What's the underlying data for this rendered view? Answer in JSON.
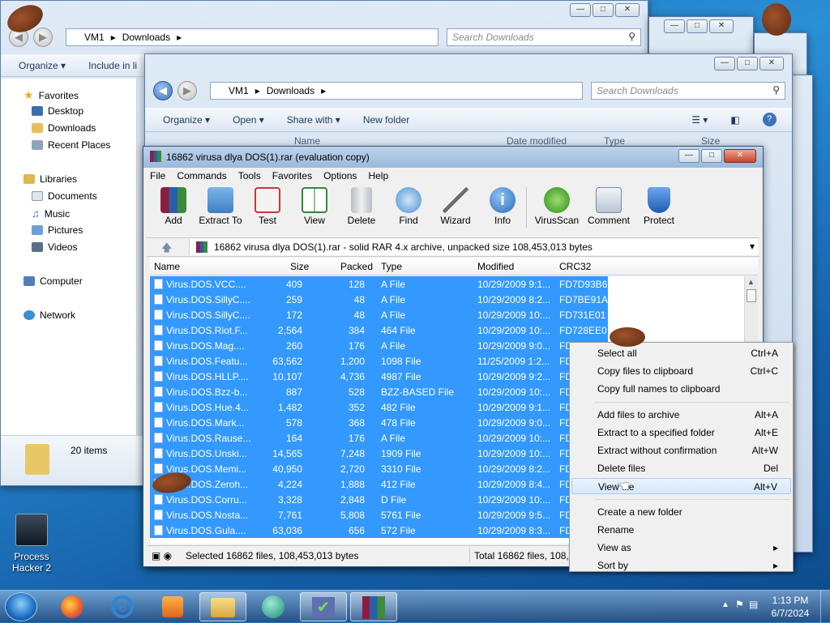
{
  "explorer_back": {
    "address": [
      "VM1",
      "Downloads"
    ],
    "search_placeholder": "Search Downloads",
    "toolbar": [
      "Organize ▾",
      "Include in li"
    ],
    "nav": {
      "favorites": "Favorites",
      "desktop": "Desktop",
      "downloads": "Downloads",
      "recent": "Recent Places",
      "libraries": "Libraries",
      "documents": "Documents",
      "music": "Music",
      "pictures": "Pictures",
      "videos": "Videos",
      "computer": "Computer",
      "network": "Network"
    },
    "status": "20 items"
  },
  "explorer_front": {
    "address": [
      "VM1",
      "Downloads"
    ],
    "search_placeholder": "Search Downloads",
    "toolbar": {
      "organize": "Organize ▾",
      "open": "Open ▾",
      "share": "Share with ▾",
      "new_folder": "New folder"
    },
    "headers": {
      "name": "Name",
      "date": "Date modified",
      "type": "Type",
      "size": "Size"
    }
  },
  "winrar": {
    "title": "16862 virusa dlya DOS(1).rar (evaluation copy)",
    "menu": [
      "File",
      "Commands",
      "Tools",
      "Favorites",
      "Options",
      "Help"
    ],
    "tools": [
      "Add",
      "Extract To",
      "Test",
      "View",
      "Delete",
      "Find",
      "Wizard",
      "Info",
      "VirusScan",
      "Comment",
      "Protect"
    ],
    "archive_path": "16862 virusa dlya DOS(1).rar - solid RAR 4.x archive, unpacked size 108,453,013 bytes",
    "columns": {
      "name": "Name",
      "size": "Size",
      "packed": "Packed",
      "type": "Type",
      "modified": "Modified",
      "crc": "CRC32"
    },
    "rows": [
      {
        "name": "Virus.DOS.VCC....",
        "size": "409",
        "packed": "128",
        "type": "A File",
        "modified": "10/29/2009 9:1...",
        "crc": "FD7D93B6"
      },
      {
        "name": "Virus.DOS.SillyC....",
        "size": "259",
        "packed": "48",
        "type": "A File",
        "modified": "10/29/2009 8:2...",
        "crc": "FD7BE91A"
      },
      {
        "name": "Virus.DOS.SillyC....",
        "size": "172",
        "packed": "48",
        "type": "A File",
        "modified": "10/29/2009 10:...",
        "crc": "FD731E01"
      },
      {
        "name": "Virus.DOS.Riot.F...",
        "size": "2,564",
        "packed": "384",
        "type": "464 File",
        "modified": "10/29/2009 10:...",
        "crc": "FD728EE0"
      },
      {
        "name": "Virus.DOS.Mag....",
        "size": "260",
        "packed": "176",
        "type": "A File",
        "modified": "10/29/2009 9:0...",
        "crc": "FD"
      },
      {
        "name": "Virus.DOS.Featu...",
        "size": "63,562",
        "packed": "1,200",
        "type": "1098 File",
        "modified": "11/25/2009 1:2...",
        "crc": "FD"
      },
      {
        "name": "Virus.DOS.HLLP....",
        "size": "10,107",
        "packed": "4,736",
        "type": "4987 File",
        "modified": "10/29/2009 9:2...",
        "crc": "FD"
      },
      {
        "name": "Virus.DOS.Bzz-b...",
        "size": "887",
        "packed": "528",
        "type": "BZZ-BASED File",
        "modified": "10/29/2009 10:...",
        "crc": "FD"
      },
      {
        "name": "Virus.DOS.Hue.4...",
        "size": "1,482",
        "packed": "352",
        "type": "482 File",
        "modified": "10/29/2009 9:1...",
        "crc": "FD"
      },
      {
        "name": "Virus.DOS.Mark...",
        "size": "578",
        "packed": "368",
        "type": "478 File",
        "modified": "10/29/2009 9:0...",
        "crc": "FD"
      },
      {
        "name": "Virus.DOS.Rause...",
        "size": "164",
        "packed": "176",
        "type": "A File",
        "modified": "10/29/2009 10:...",
        "crc": "FD"
      },
      {
        "name": "Virus.DOS.Unski...",
        "size": "14,565",
        "packed": "7,248",
        "type": "1909 File",
        "modified": "10/29/2009 10:...",
        "crc": "FD"
      },
      {
        "name": "Virus.DOS.Memi...",
        "size": "40,950",
        "packed": "2,720",
        "type": "3310 File",
        "modified": "10/29/2009 8:2...",
        "crc": "FD"
      },
      {
        "name": "Virus.DOS.Zeroh...",
        "size": "4,224",
        "packed": "1,888",
        "type": "412 File",
        "modified": "10/29/2009 8:4...",
        "crc": "FD"
      },
      {
        "name": "Virus.DOS.Corru...",
        "size": "3,328",
        "packed": "2,848",
        "type": "D File",
        "modified": "10/29/2009 10:...",
        "crc": "FD"
      },
      {
        "name": "Virus.DOS.Nosta...",
        "size": "7,761",
        "packed": "5,808",
        "type": "5761 File",
        "modified": "10/29/2009 9:5...",
        "crc": "FD"
      },
      {
        "name": "Virus.DOS.Gula....",
        "size": "63,036",
        "packed": "656",
        "type": "572 File",
        "modified": "10/29/2009 8:3...",
        "crc": "FD"
      }
    ],
    "status_selected": "Selected 16862 files, 108,453,013 bytes",
    "status_total": "Total 16862 files, 108,4"
  },
  "context_menu": {
    "groups": [
      [
        {
          "label": "Select all",
          "key": "Ctrl+A"
        },
        {
          "label": "Copy files to clipboard",
          "key": "Ctrl+C"
        },
        {
          "label": "Copy full names to clipboard",
          "key": ""
        }
      ],
      [
        {
          "label": "Add files to archive",
          "key": "Alt+A"
        },
        {
          "label": "Extract to a specified folder",
          "key": "Alt+E"
        },
        {
          "label": "Extract without confirmation",
          "key": "Alt+W"
        },
        {
          "label": "Delete files",
          "key": "Del"
        },
        {
          "label": "View file",
          "key": "Alt+V"
        }
      ],
      [
        {
          "label": "Create a new folder",
          "key": ""
        },
        {
          "label": "Rename",
          "key": ""
        },
        {
          "label": "View as",
          "key": "▸"
        },
        {
          "label": "Sort by",
          "key": "▸"
        }
      ]
    ],
    "highlighted": "View file"
  },
  "desktop": {
    "process_hacker": "Process\nHacker 2"
  },
  "taskbar": {
    "time": "1:13 PM",
    "date": "6/7/2024"
  },
  "colors": {
    "selection": "#3399ff",
    "accent": "#1e395b"
  }
}
